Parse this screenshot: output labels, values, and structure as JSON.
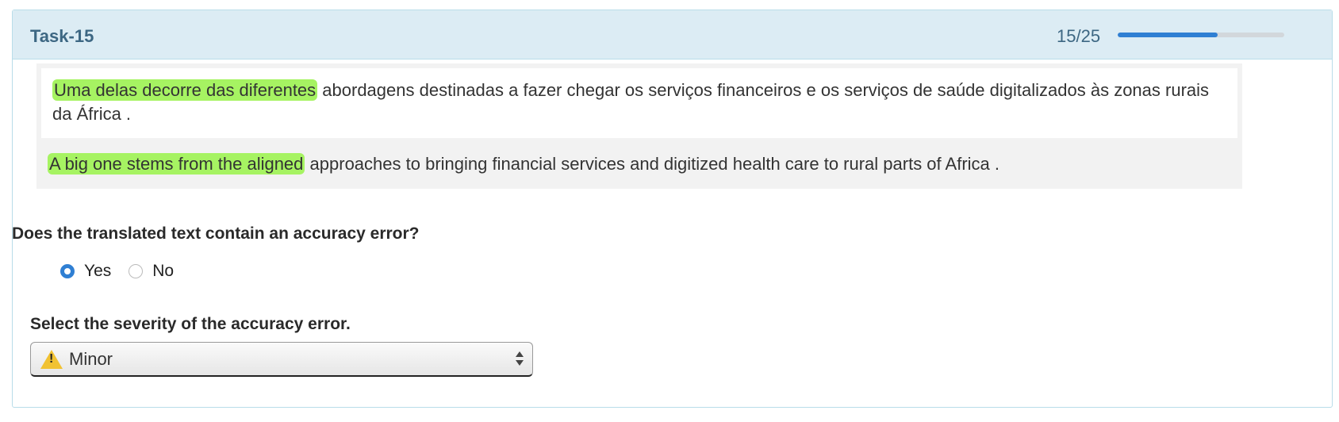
{
  "task": {
    "title": "Task-15",
    "progress_text": "15/25",
    "progress_fraction": 0.6
  },
  "source": {
    "highlight": "Uma delas decorre das diferentes",
    "rest": " abordagens destinadas a fazer chegar os serviços financeiros e os serviços de saúde digitalizados às zonas rurais da África ."
  },
  "target": {
    "highlight": "A big one stems from the aligned",
    "rest": " approaches to bringing financial services and digitized health care to rural parts of Africa ."
  },
  "question": {
    "text": "Does the translated text contain an accuracy error?",
    "options": [
      "Yes",
      "No"
    ],
    "selected": "Yes"
  },
  "severity": {
    "label": "Select the severity of the accuracy error.",
    "value": "Minor",
    "icon": "warning-icon"
  },
  "colors": {
    "header_bg": "#dcecf4",
    "accent": "#2f7fd3",
    "highlight": "#a6f362",
    "title": "#3d6783"
  }
}
